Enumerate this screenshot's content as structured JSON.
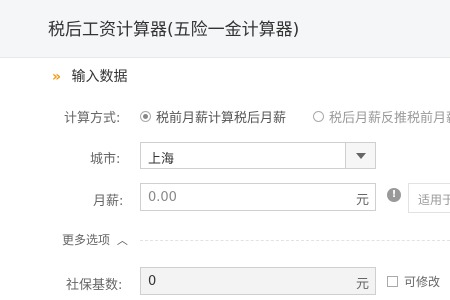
{
  "header": {
    "title": "税后工资计算器(五险一金计算器)"
  },
  "section": {
    "chevron": "»",
    "title": "输入数据"
  },
  "calc_mode": {
    "label": "计算方式:",
    "options": [
      {
        "label": "税前月薪计算税后月薪",
        "checked": true
      },
      {
        "label": "税后月薪反推税前月薪",
        "checked": false
      }
    ]
  },
  "city": {
    "label": "城市:",
    "value": "上海",
    "icon": "chevron-down-icon"
  },
  "salary": {
    "label": "月薪:",
    "placeholder": "0.00",
    "unit": "元",
    "info_icon": "!",
    "tip": "适用于"
  },
  "more_options": {
    "label": "更多选项",
    "caret": "︿"
  },
  "social_base": {
    "label": "社保基数:",
    "value": "0",
    "unit": "元",
    "editable_label": "可修改"
  }
}
